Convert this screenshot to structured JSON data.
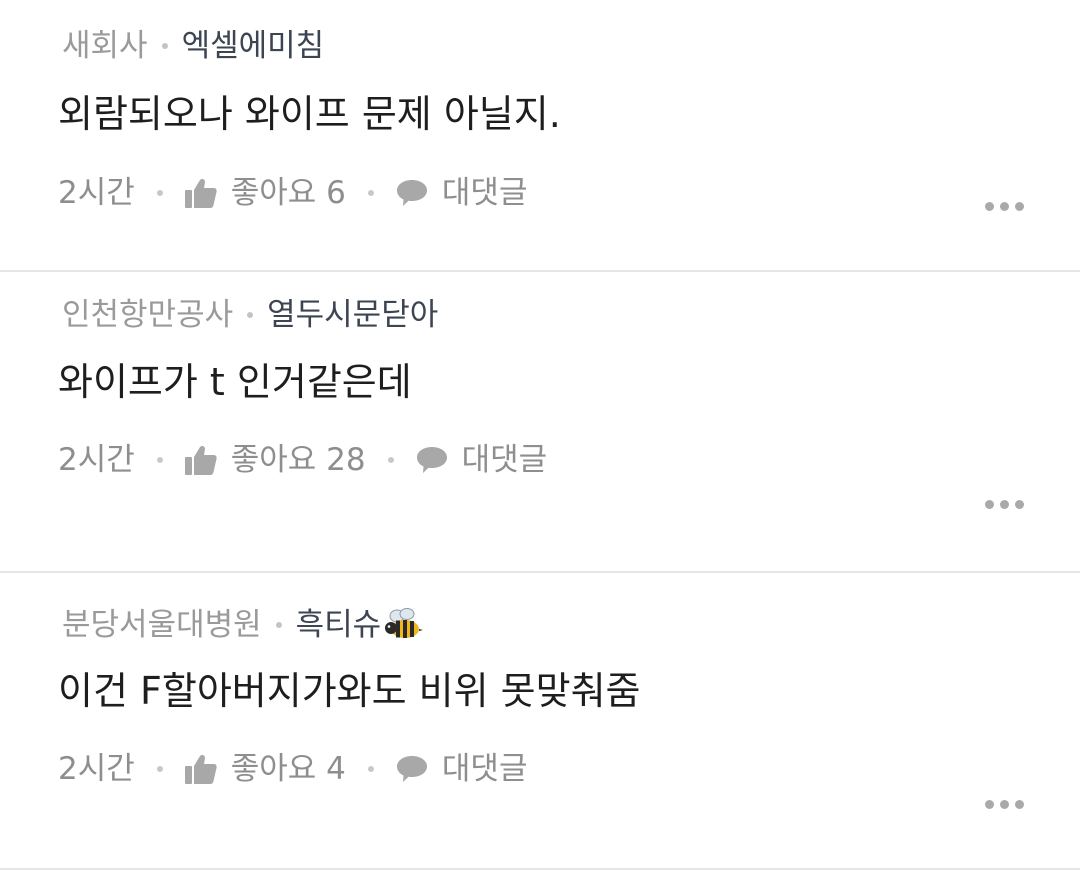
{
  "comments": [
    {
      "company": "새회사",
      "nickname": "엑셀에미침",
      "text": "외람되오나 와이프 문제 아닐지.",
      "time": "2시간",
      "like_label": "좋아요 6",
      "reply_label": "대댓글"
    },
    {
      "company": "인천항만공사",
      "nickname": "열두시문닫아",
      "text": "와이프가 t 인거같은데",
      "time": "2시간",
      "like_label": "좋아요 28",
      "reply_label": "대댓글"
    },
    {
      "company": "분당서울대병원",
      "nickname": "흑티슈",
      "nickname_icon": "bee-emoji",
      "text": "이건 F할아버지가와도 비위 못맞춰줌",
      "time": "2시간",
      "like_label": "좋아요 4",
      "reply_label": "대댓글"
    }
  ],
  "icons": {
    "like": "thumbs-up-icon",
    "reply": "speech-bubble-icon",
    "more": "more-dots-icon"
  },
  "colors": {
    "company": "#9a9a9a",
    "nickname": "#3d4553",
    "meta": "#8e8e8e",
    "divider": "#e6e6e6"
  }
}
